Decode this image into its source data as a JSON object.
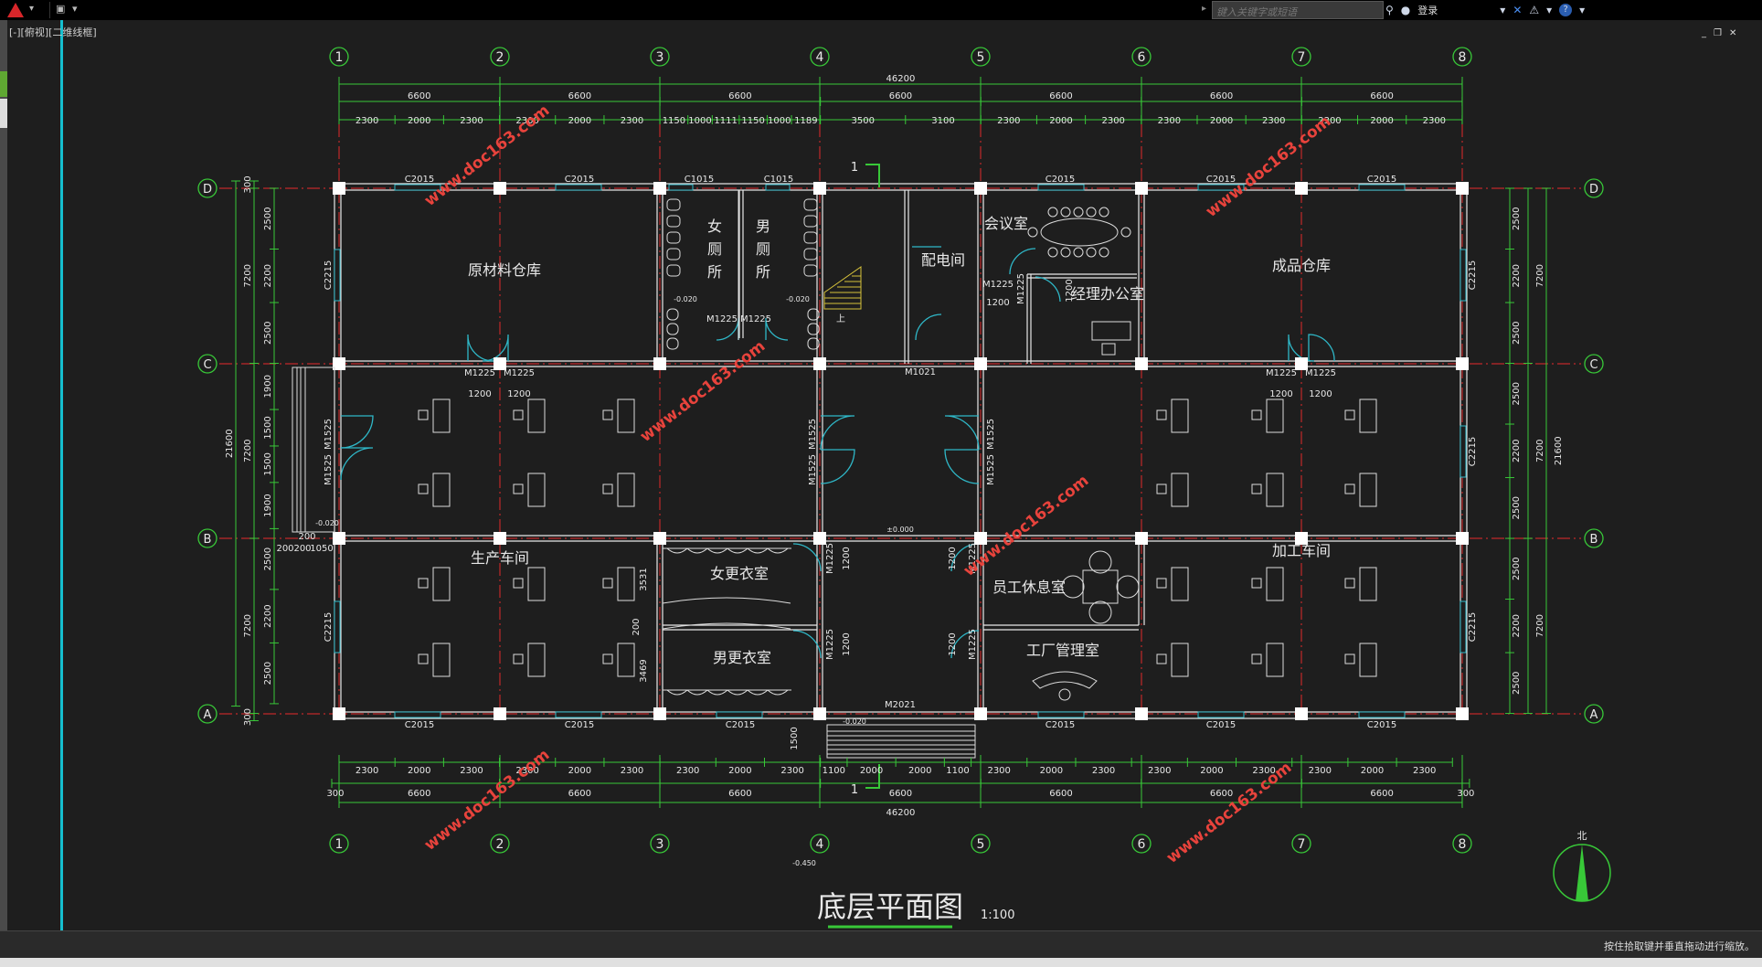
{
  "app": {
    "search_placeholder": "键入关键字或短语",
    "login_label": "登录",
    "viewport_label": "[-][俯视][二维线框]",
    "status_text": "按住拾取键并垂直拖动进行缩放。"
  },
  "drawing": {
    "title": "底层平面图",
    "scale": "1:100",
    "north": "北",
    "grid_numbers": [
      "1",
      "2",
      "3",
      "4",
      "5",
      "6",
      "7",
      "8"
    ],
    "grid_letters": [
      "D",
      "C",
      "B",
      "A"
    ],
    "watermark": "www.doc163.com",
    "dims": {
      "overall": "46200",
      "bay": "6600",
      "outer": "300",
      "depth_total": "21600",
      "depth_bay": "7200",
      "top_sub": [
        "2300",
        "2000",
        "2300",
        "2300",
        "2000",
        "2300",
        "1150",
        "1000",
        "1111",
        "1150",
        "1000",
        "1189",
        "3500",
        "3100",
        "2300",
        "2000",
        "2300",
        "2300",
        "2000",
        "2300",
        "2300",
        "2000",
        "2300"
      ],
      "bottom_sub": [
        "2300",
        "2000",
        "2300",
        "2300",
        "2000",
        "2300",
        "2300",
        "2000",
        "2300",
        "1100",
        "2000",
        "2000",
        "1100",
        "2300",
        "2000",
        "2300",
        "2300",
        "2000",
        "2300",
        "2300",
        "2000",
        "2300"
      ],
      "left_sub": [
        "300",
        "2500",
        "2200",
        "2500",
        "1900",
        "1500",
        "1500",
        "1900",
        "2500",
        "2200",
        "2500",
        "300"
      ],
      "right_sub": [
        "2500",
        "2200",
        "2500",
        "2500",
        "2200",
        "2500",
        "2500",
        "2200",
        "2500"
      ]
    },
    "rooms": {
      "raw_store": "原材料仓库",
      "wc_f1": "女",
      "wc_f2": "厕",
      "wc_f3": "所",
      "wc_m1": "男",
      "wc_m2": "厕",
      "wc_m3": "所",
      "power_room": "配电间",
      "meeting": "会议室",
      "manager": "经理办公室",
      "product_store": "成品仓库",
      "production": "生产车间",
      "female_locker": "女更衣室",
      "male_locker": "男更衣室",
      "staff_lounge": "员工休息室",
      "plant_mgmt": "工厂管理室",
      "processing": "加工车间",
      "stair_up": "上"
    },
    "labels": {
      "c2015": "C2015",
      "c1015": "C1015",
      "c2215": "C2215",
      "m1225": "M1225",
      "m1525": "M1525",
      "m1021": "M1021",
      "m2021": "M2021",
      "d1200": "1200",
      "section": "1",
      "lvl_0": "±0.000",
      "lvl_m20": "-0.020",
      "lvl_m450": "-0.450",
      "lvl_m620": "-0.020",
      "d1500": "1500",
      "d3531": "3531",
      "d3469": "3469",
      "d200": "200",
      "d1050": "1050",
      "d200b": "200"
    }
  }
}
